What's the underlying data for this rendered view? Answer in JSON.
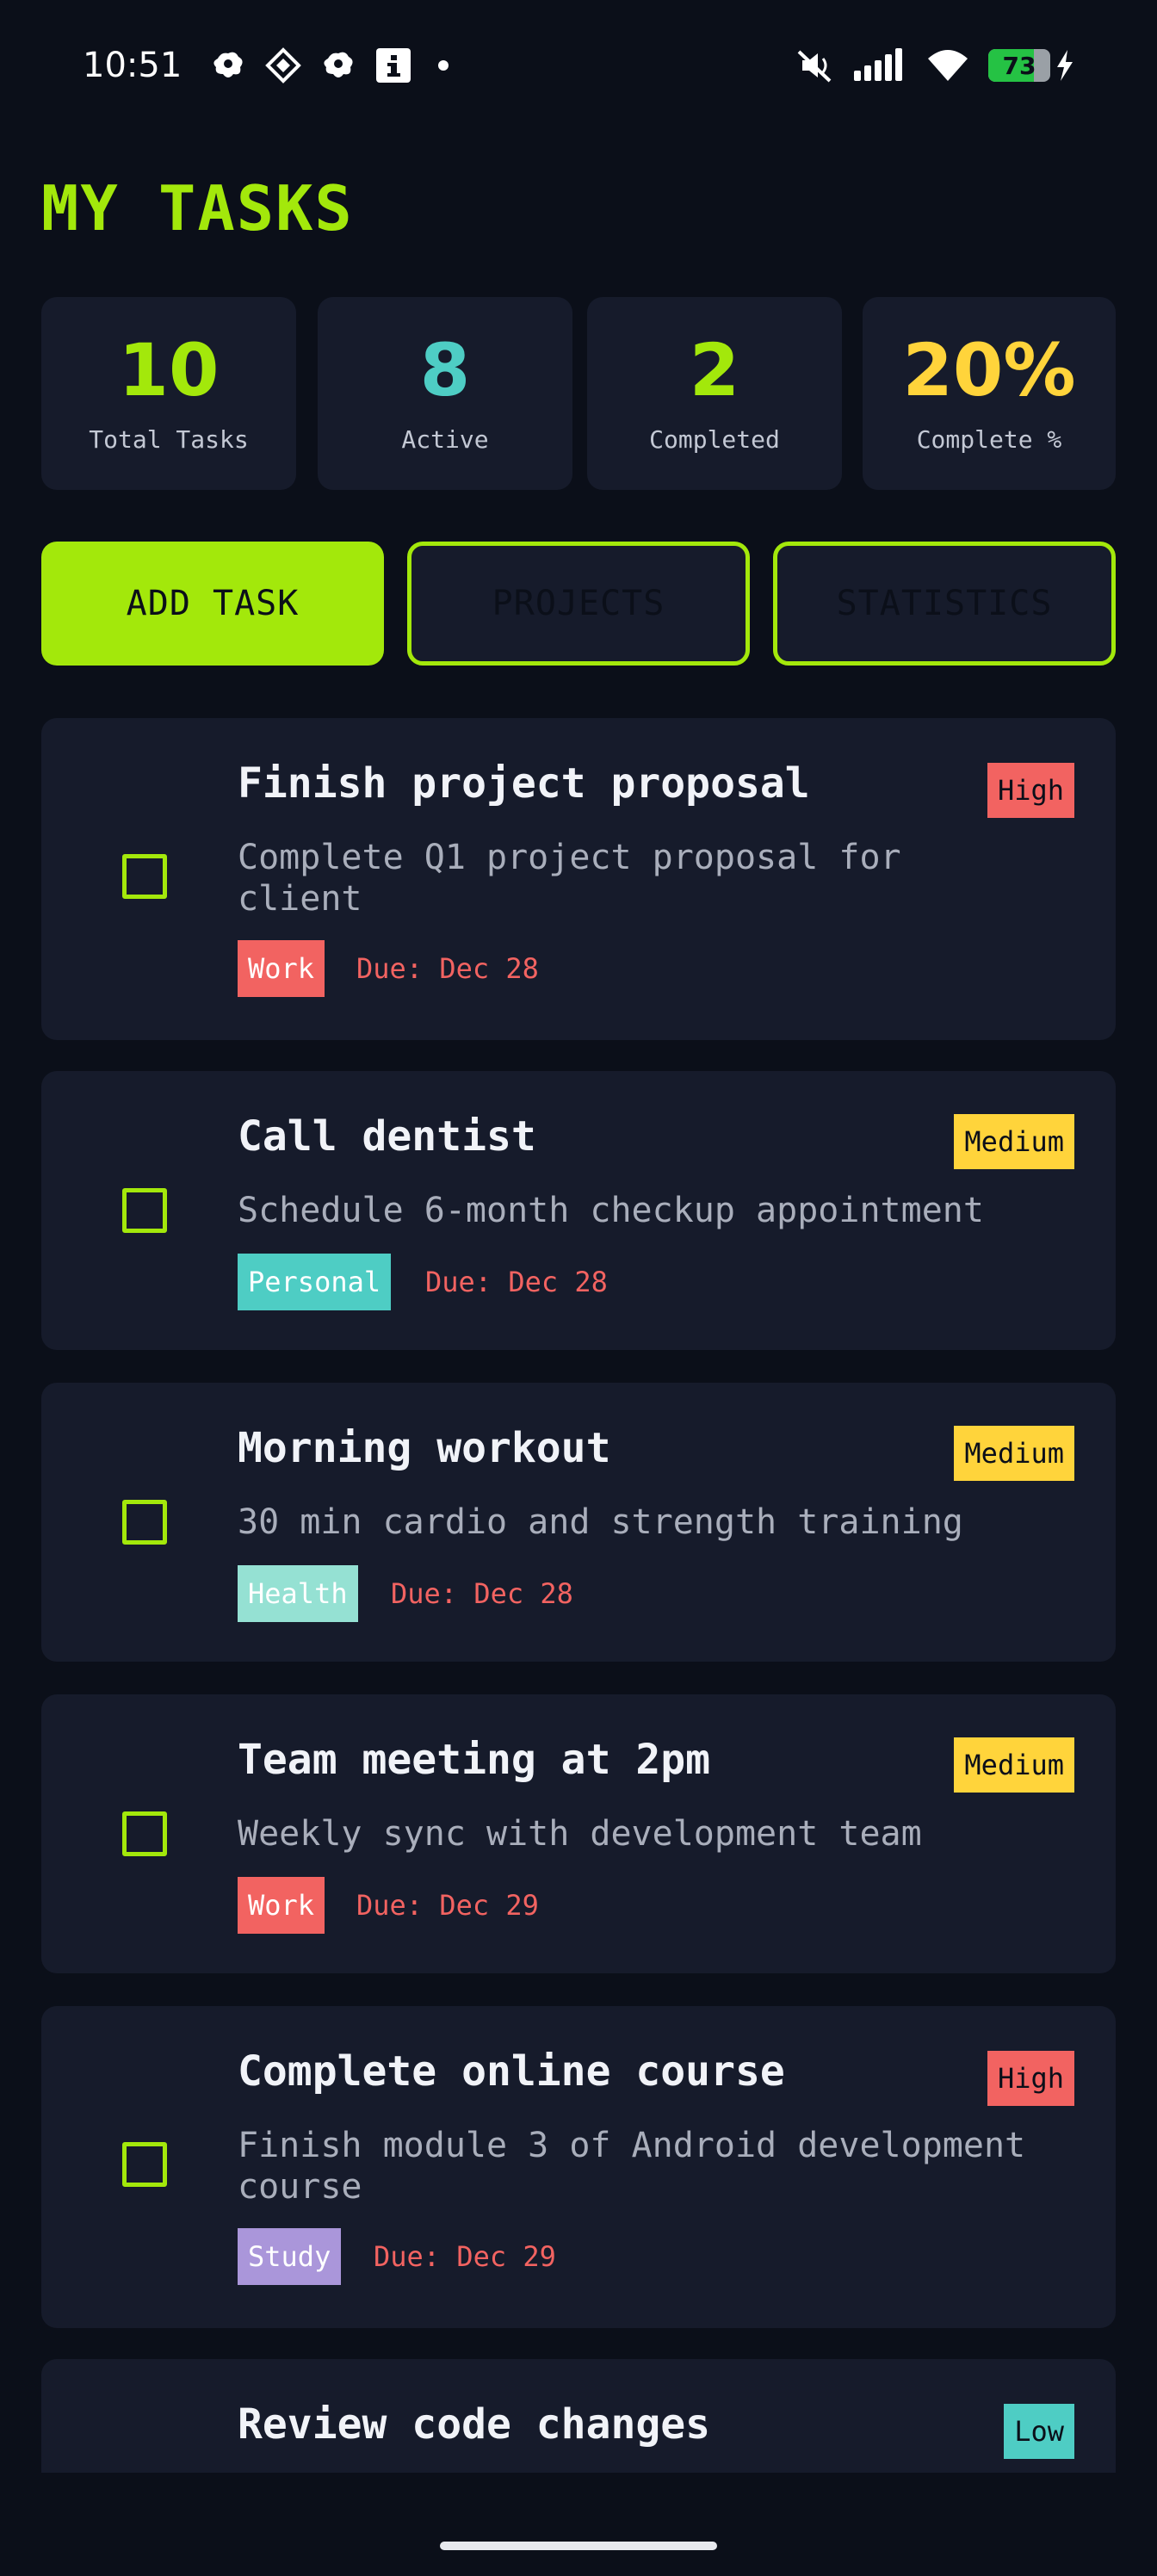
{
  "status_bar": {
    "time": "10:51",
    "battery": "73",
    "battery_level": 0.73,
    "left_icons": [
      "notification-app-icon",
      "diamond-app-icon",
      "notification-app-icon",
      "info-app-icon"
    ],
    "right_icons": [
      "mute-icon",
      "signal-icon",
      "wifi-icon",
      "battery-icon",
      "charging-icon"
    ]
  },
  "header": {
    "title": "MY TASKS"
  },
  "stats": [
    {
      "value": "10",
      "label": "Total Tasks",
      "color": "#a3e80b"
    },
    {
      "value": "8",
      "label": "Active",
      "color": "#4ecdc4"
    },
    {
      "value": "2",
      "label": "Completed",
      "color": "#a3e80b"
    },
    {
      "value": "20%",
      "label": "Complete %",
      "color": "#ffd43b"
    }
  ],
  "actions": {
    "add_task": "ADD TASK",
    "projects": "PROJECTS",
    "statistics": "STATISTICS"
  },
  "tasks": [
    {
      "title": "Finish project proposal",
      "description": "Complete Q1 project proposal for client",
      "category": "Work",
      "category_color": "#f26361",
      "due": "Due: Dec 28",
      "priority": "High",
      "priority_color": "#f26361",
      "completed": false
    },
    {
      "title": "Call dentist",
      "description": "Schedule 6-month checkup appointment",
      "category": "Personal",
      "category_color": "#4ecdc4",
      "due": "Due: Dec 28",
      "priority": "Medium",
      "priority_color": "#ffd43b",
      "completed": false
    },
    {
      "title": "Morning workout",
      "description": "30 min cardio and strength training",
      "category": "Health",
      "category_color": "#95e1d3",
      "due": "Due: Dec 28",
      "priority": "Medium",
      "priority_color": "#ffd43b",
      "completed": false
    },
    {
      "title": "Team meeting at 2pm",
      "description": "Weekly sync with development team",
      "category": "Work",
      "category_color": "#f26361",
      "due": "Due: Dec 29",
      "priority": "Medium",
      "priority_color": "#ffd43b",
      "completed": false
    },
    {
      "title": "Complete online course",
      "description": "Finish module 3 of Android development course",
      "category": "Study",
      "category_color": "#aa96da",
      "due": "Due: Dec 29",
      "priority": "High",
      "priority_color": "#f26361",
      "completed": false
    },
    {
      "title": "Review code changes",
      "description": "",
      "category": "",
      "category_color": "",
      "due": "",
      "priority": "Low",
      "priority_color": "#4ecdc4",
      "completed": false
    }
  ],
  "colors": {
    "accent": "#a3e80b",
    "background": "#0b0f19",
    "card": "#161b2b",
    "due_text": "#f26361"
  }
}
